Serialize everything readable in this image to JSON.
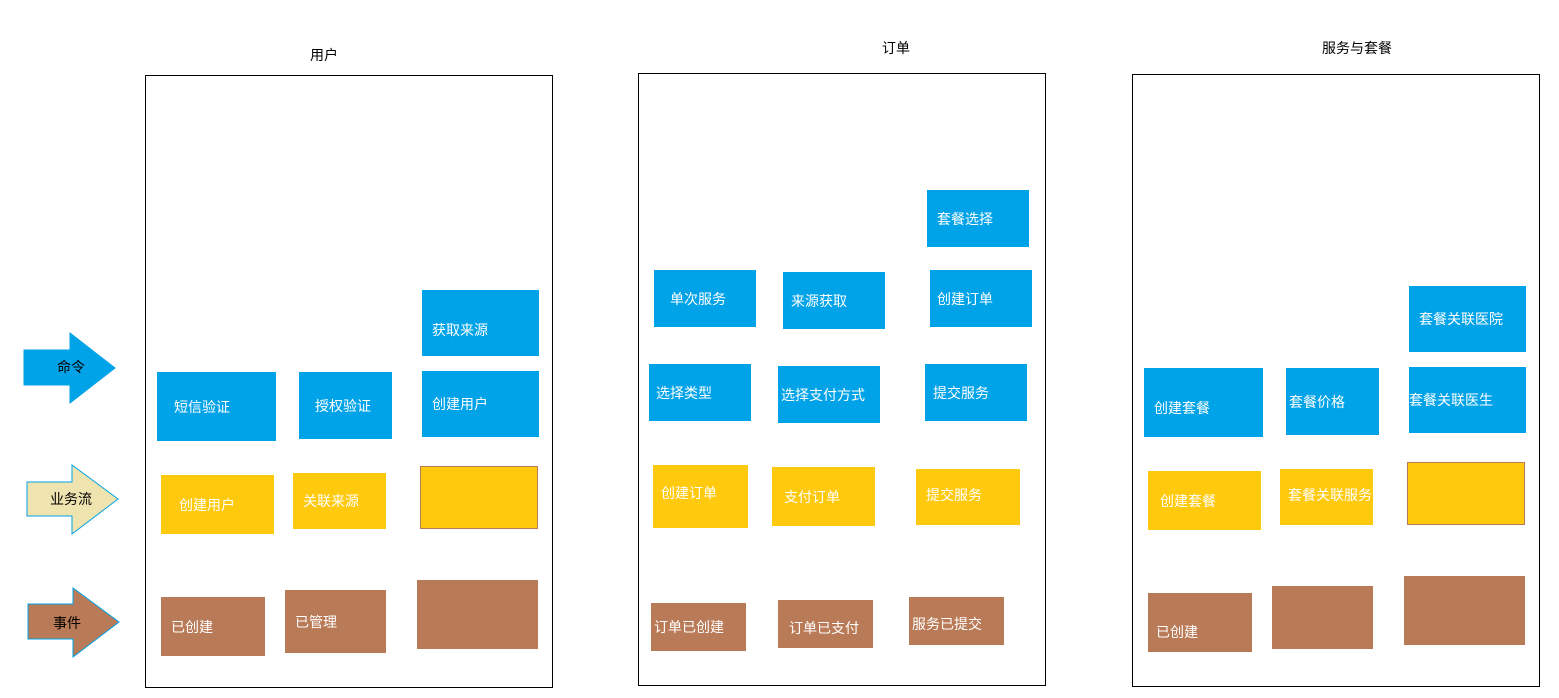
{
  "legend": {
    "command": "命令",
    "flow": "业务流",
    "event": "事件"
  },
  "colors": {
    "command": "#00a2e8",
    "flow": "#ffc90e",
    "event": "#b97a57",
    "flow_arrow": "#efe4b0"
  },
  "user": {
    "title": "用户",
    "commands": [
      "获取来源",
      "短信验证",
      "授权验证",
      "创建用户"
    ],
    "flows": [
      "创建用户",
      "关联来源",
      ""
    ],
    "events": [
      "已创建",
      "已管理",
      ""
    ]
  },
  "order": {
    "title": "订单",
    "commands": [
      "套餐选择",
      "单次服务",
      "来源获取",
      "创建订单",
      "选择类型",
      "选择支付方式",
      "提交服务"
    ],
    "flows": [
      "创建订单",
      "支付订单",
      "提交服务"
    ],
    "events": [
      "订单已创建",
      "订单已支付",
      "服务已提交"
    ]
  },
  "package": {
    "title": "服务与套餐",
    "commands": [
      "套餐关联医院",
      "创建套餐",
      "套餐价格",
      "套餐关联医生"
    ],
    "flows": [
      "创建套餐",
      "套餐关联服务",
      ""
    ],
    "events": [
      "已创建",
      "",
      ""
    ]
  }
}
